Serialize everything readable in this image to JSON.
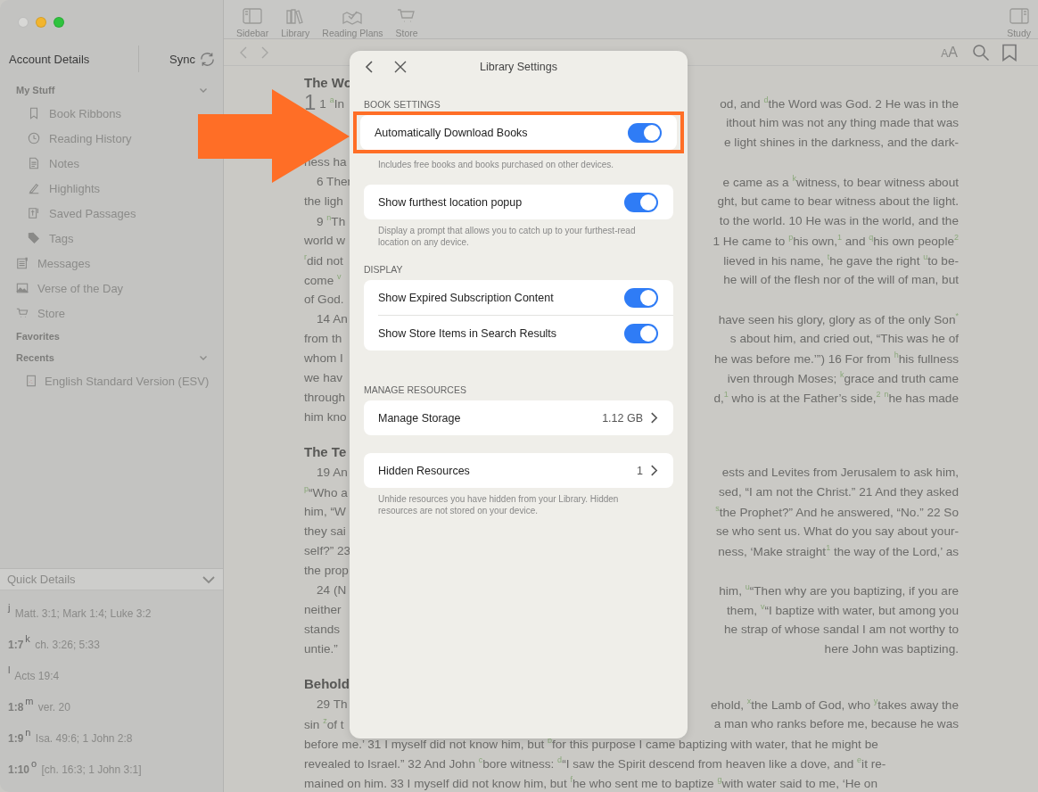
{
  "sidebar": {
    "account": "Account Details",
    "sync": "Sync",
    "my_stuff": {
      "title": "My Stuff",
      "expanded": true,
      "items": [
        "Book Ribbons",
        "Reading History",
        "Notes",
        "Highlights",
        "Saved Passages",
        "Tags"
      ]
    },
    "links": [
      "Messages",
      "Verse of the Day",
      "Store"
    ],
    "favorites": {
      "title": "Favorites"
    },
    "recents": {
      "title": "Recents",
      "expanded": true,
      "items": [
        "English Standard Version (ESV)"
      ]
    }
  },
  "quick_details": {
    "title": "Quick Details",
    "expanded": true,
    "items": [
      {
        "note": "j",
        "text": "Matt. 3:1; Mark 1:4; Luke 3:2"
      },
      {
        "ref": "1:7",
        "note": "k",
        "text": "ch. 3:26; 5:33"
      },
      {
        "note": "l",
        "text": "Acts 19:4"
      },
      {
        "ref": "1:8",
        "note": "m",
        "text": "ver. 20"
      },
      {
        "ref": "1:9",
        "note": "n",
        "text": "Isa. 49:6; 1 John 2:8"
      },
      {
        "ref": "1:10",
        "note": "o",
        "text": "[ch. 16:3; 1 John 3:1]"
      }
    ]
  },
  "toolbar": {
    "buttons": [
      "Sidebar",
      "Library",
      "Reading Plans",
      "Store"
    ],
    "study": "Study"
  },
  "nav": {
    "font_size": [
      "A",
      "A"
    ]
  },
  "reader": {
    "blocks": [
      {
        "kind": "heading",
        "text": "The Wo"
      },
      {
        "kind": "chapter",
        "number": "1",
        "left": "1 $^{a}$In",
        "right": "od, and $^{d}$the Word was God. 2 He was in the"
      },
      {
        "kind": "line",
        "right": "ithout him was not any thing made that was"
      },
      {
        "kind": "line",
        "right": "e light shines in the darkness, and the dark-"
      },
      {
        "kind": "line",
        "left": "ness ha"
      },
      {
        "kind": "para",
        "left": "6 Ther",
        "right": "e came as a $^{k}$witness, to bear witness about"
      },
      {
        "kind": "line",
        "left": "the ligh",
        "right": "ght, but came to bear witness about the light."
      },
      {
        "kind": "para",
        "left": "9 $^{n}$Th",
        "right": "to the world. 10 He was in the world, and the"
      },
      {
        "kind": "line",
        "left": "world w",
        "right": "1 He came to $^{p}$his own,$^{1}$ and $^{q}$his own people$^{2}$"
      },
      {
        "kind": "line",
        "left": "$^{r}$did not",
        "right": "lieved in his name, $^{t}$he gave the right $^{u}$to be-"
      },
      {
        "kind": "line",
        "left": "come $^{v}$",
        "right": "he will of the flesh nor of the will of man, but"
      },
      {
        "kind": "line",
        "left": "of God."
      },
      {
        "kind": "para",
        "left": "14 An",
        "right": "have seen his glory, glory as of the only Son$^{*}$"
      },
      {
        "kind": "line",
        "left": "from th",
        "right": "s about him, and cried out, “This was he of"
      },
      {
        "kind": "line",
        "left": "whom I",
        "right": "he was before me.’”) 16 For from $^{h}$his fullness"
      },
      {
        "kind": "line",
        "left": "we hav",
        "right": "iven through Moses; $^{k}$grace and truth came"
      },
      {
        "kind": "line",
        "left": "through",
        "right": "d,$^{1}$ who is at the Father’s side,$^{2}$ $^{n}$he has made"
      },
      {
        "kind": "line",
        "left": "him kno"
      },
      {
        "kind": "heading",
        "text": "The Te"
      },
      {
        "kind": "para",
        "left": "19 An",
        "right": "ests and Levites from Jerusalem to ask him,"
      },
      {
        "kind": "line",
        "left": "$^{p}$“Who a",
        "right": "sed, “I am not the Christ.” 21 And they asked"
      },
      {
        "kind": "line",
        "left": "him, “W",
        "right": "$^{s}$the Prophet?” And he answered, “No.” 22 So"
      },
      {
        "kind": "line",
        "left": "they sai",
        "right": "se who sent us. What do you say about your-"
      },
      {
        "kind": "line",
        "left": "self?” 23",
        "right": "ness, ‘Make straight$^{1}$ the way of the Lord,’ as"
      },
      {
        "kind": "line",
        "left": "the prop"
      },
      {
        "kind": "para",
        "left": "24 (N",
        "right": "him, $^{u}$“Then why are you baptizing, if you are"
      },
      {
        "kind": "line",
        "left": "neither",
        "right": "them, $^{v}$“I baptize with water, but among you"
      },
      {
        "kind": "line",
        "left": "stands",
        "right": "he strap of whose sandal I am not worthy to"
      },
      {
        "kind": "line",
        "left": "untie.”",
        "right": "here John was baptizing."
      },
      {
        "kind": "heading",
        "text": "Behold"
      },
      {
        "kind": "para",
        "left": "29 Th",
        "right": "ehold, $^{x}$the Lamb of God, who $^{y}$takes away the"
      },
      {
        "kind": "line",
        "left": "sin $^{z}$of t",
        "right": "a man who ranks before me, because he was"
      },
      {
        "kind": "line",
        "left": "before me.’ 31 I myself did not know him, but $^{b}$for this purpose I came baptizing with water, that he might be"
      },
      {
        "kind": "line",
        "left": "revealed to Israel.” 32 And John $^{c}$bore witness: $^{d}$“I saw the Spirit descend from heaven like a dove, and $^{e}$it re-"
      },
      {
        "kind": "line",
        "left": "mained on him. 33 I myself did not know him, but $^{f}$he who sent me to baptize $^{g}$with water said to me, ‘He on"
      }
    ]
  },
  "dialog": {
    "title": "Library Settings",
    "sections": [
      {
        "title": "BOOK SETTINGS",
        "groups": [
          {
            "rows": [
              {
                "kind": "toggle",
                "label": "Automatically Download Books",
                "on": true,
                "highlighted": true
              }
            ],
            "hint": "Includes free books and books purchased on other devices."
          },
          {
            "rows": [
              {
                "kind": "toggle",
                "label": "Show furthest location popup",
                "on": true
              }
            ],
            "hint": "Display a prompt that allows you to catch up to your furthest-read location on any device."
          }
        ]
      },
      {
        "title": "DISPLAY",
        "groups": [
          {
            "rows": [
              {
                "kind": "toggle",
                "label": "Show Expired Subscription Content",
                "on": true
              },
              {
                "kind": "toggle",
                "label": "Show Store Items in Search Results",
                "on": true
              }
            ]
          }
        ]
      },
      {
        "title": "MANAGE RESOURCES",
        "groups": [
          {
            "rows": [
              {
                "kind": "link",
                "label": "Manage Storage",
                "value": "1.12 GB"
              }
            ]
          },
          {
            "rows": [
              {
                "kind": "link",
                "label": "Hidden Resources",
                "value": "1"
              }
            ],
            "hint": "Unhide resources you have hidden from your Library. Hidden resources are not stored on your device."
          }
        ]
      }
    ]
  }
}
